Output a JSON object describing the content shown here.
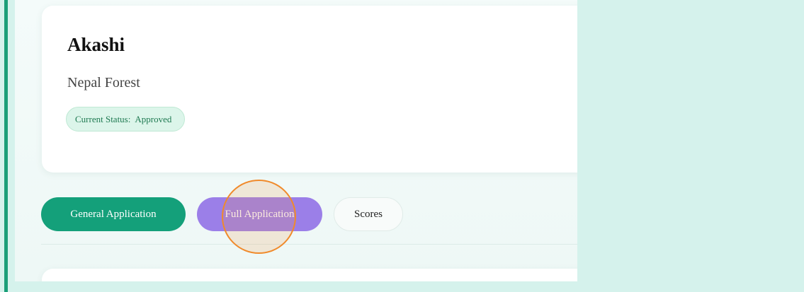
{
  "profile": {
    "name": "Akashi",
    "organization": "Nepal Forest",
    "status_label": "Current Status:",
    "status_value": "Approved"
  },
  "tabs": [
    {
      "label": "General Application",
      "active": true
    },
    {
      "label": "Full Application",
      "active": false
    },
    {
      "label": "Scores",
      "active": false
    }
  ],
  "colors": {
    "accent_green": "#14a07a",
    "accent_purple": "#9b7fe8",
    "background_mint": "#d5f2ec",
    "click_indicator": "#f08a2b"
  }
}
